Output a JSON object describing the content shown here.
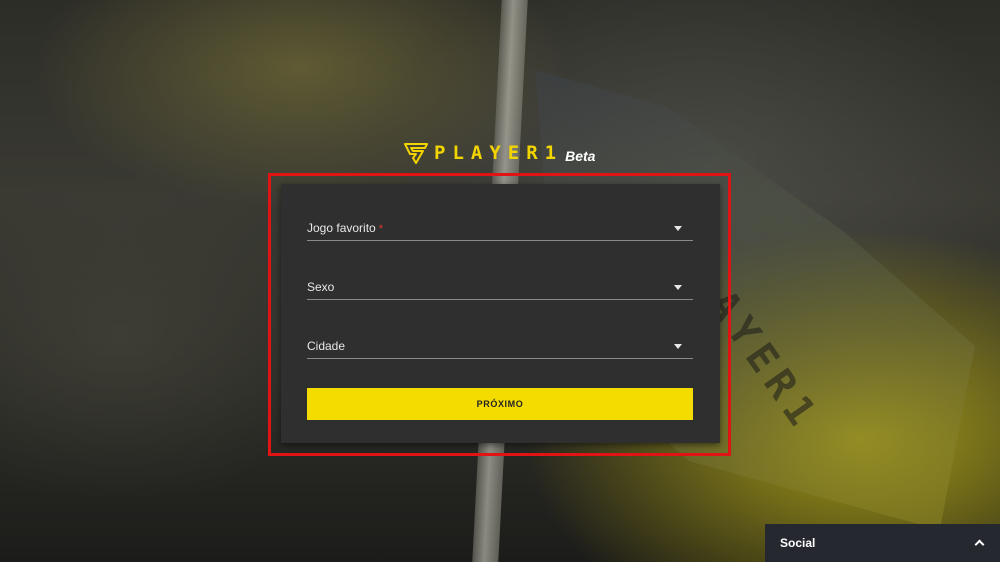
{
  "logo": {
    "name": "PLAYER1",
    "badge": "Beta",
    "icon": "player1-logo-icon"
  },
  "form": {
    "fields": [
      {
        "label": "Jogo favorito",
        "required_mark": "*",
        "icon": "chevron-down-icon"
      },
      {
        "label": "Sexo",
        "icon": "chevron-down-icon"
      },
      {
        "label": "Cidade",
        "icon": "chevron-down-icon"
      }
    ],
    "next_label": "PRÓXIMO"
  },
  "social": {
    "label": "Social",
    "icon": "chevron-up-icon"
  },
  "colors": {
    "accent": "#f5dc00",
    "highlight": "#e01414",
    "card": "#2f2f2f",
    "social_bar": "#25292f"
  }
}
